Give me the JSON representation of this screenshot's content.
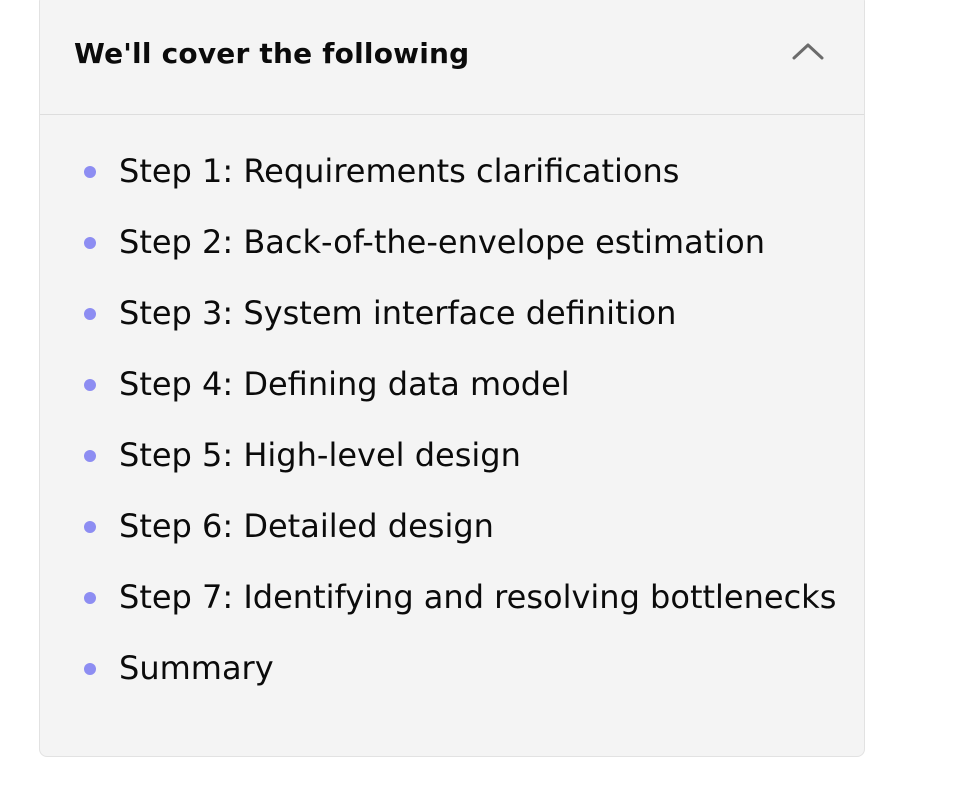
{
  "accordion": {
    "title": "We'll cover the following",
    "toggle_icon": "chevron-up-icon",
    "items": [
      {
        "label": "Step 1: Requirements clarifications"
      },
      {
        "label": "Step 2: Back-of-the-envelope estimation"
      },
      {
        "label": "Step 3: System interface definition"
      },
      {
        "label": "Step 4: Defining data model"
      },
      {
        "label": "Step 5: High-level design"
      },
      {
        "label": "Step 6: Detailed design"
      },
      {
        "label": "Step 7: Identifying and resolving bottlenecks"
      },
      {
        "label": "Summary"
      }
    ]
  },
  "colors": {
    "panel_background": "#f4f4f4",
    "bullet": "#8d8df2",
    "text": "#0b0b0b",
    "chevron": "#6b6b6b"
  }
}
